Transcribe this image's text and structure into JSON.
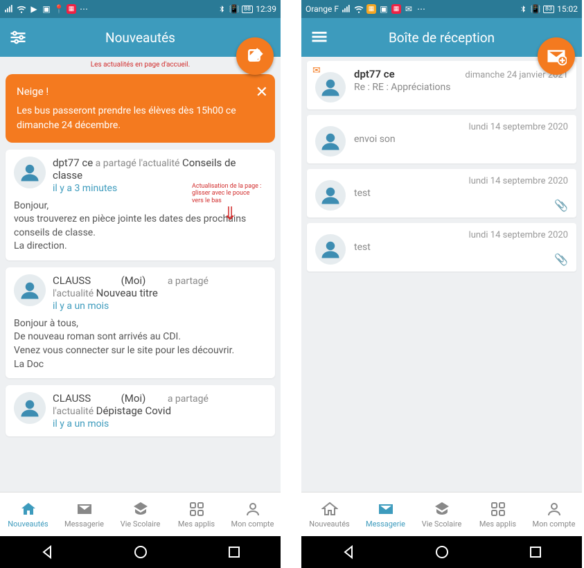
{
  "left": {
    "status": {
      "time": "12:39",
      "batt": "88"
    },
    "header": {
      "title": "Nouveautés"
    },
    "redline": "Les actualités en page d'accueil.",
    "alert": {
      "title": "Neige !",
      "body": "Les bus passeront prendre les élèves dès 15h00 ce dimanche 24 décembre."
    },
    "annot": {
      "l1": "Actualisation de la page :",
      "l2": "glisser avec le pouce",
      "l3": "vers le bas"
    },
    "posts": [
      {
        "author": "dpt77 ce",
        "me": "",
        "action": "a partagé l'actualité",
        "subject": "Conseils de classe",
        "time": "il y a 3 minutes",
        "body": "Bonjour,\nvous trouverez en pièce jointe les dates des prochains conseils de classe.\nLa direction."
      },
      {
        "author": "CLAUSS",
        "me": "(Moi)",
        "action": "a partagé",
        "actuprefix": "l'actualité",
        "subject": "Nouveau titre",
        "time": "il y a un mois",
        "body": "Bonjour à tous,\nDe nouveau roman sont arrivés au CDI.\nVenez vous connecter sur le site pour les découvrir.\nLa Doc"
      },
      {
        "author": "CLAUSS",
        "me": "(Moi)",
        "action": "a partagé",
        "actuprefix": "l'actualité",
        "subject": "Dépistage Covid",
        "time": "il y a un mois",
        "body": ""
      }
    ],
    "nav": {
      "nouv": "Nouveautés",
      "msg": "Messagerie",
      "vie": "Vie Scolaire",
      "app": "Mes applis",
      "cpt": "Mon compte"
    }
  },
  "right": {
    "status": {
      "carrier": "Orange F",
      "time": "15:02",
      "batt": "83"
    },
    "header": {
      "title": "Boîte de réception"
    },
    "messages": [
      {
        "sender": "dpt77 ce",
        "date": "dimanche 24 janvier 2021",
        "subject": "Re : RE : Appréciations",
        "unread": true
      },
      {
        "sender": "",
        "date": "lundi 14 septembre 2020",
        "subject": "envoi son",
        "unread": false,
        "attach": false
      },
      {
        "sender": "",
        "date": "lundi 14 septembre 2020",
        "subject": "test",
        "unread": false,
        "attach": true
      },
      {
        "sender": "",
        "date": "lundi 14 septembre 2020",
        "subject": "test",
        "unread": false,
        "attach": true
      }
    ],
    "nav": {
      "nouv": "Nouveautés",
      "msg": "Messagerie",
      "vie": "Vie Scolaire",
      "app": "Mes applis",
      "cpt": "Mon compte"
    }
  }
}
